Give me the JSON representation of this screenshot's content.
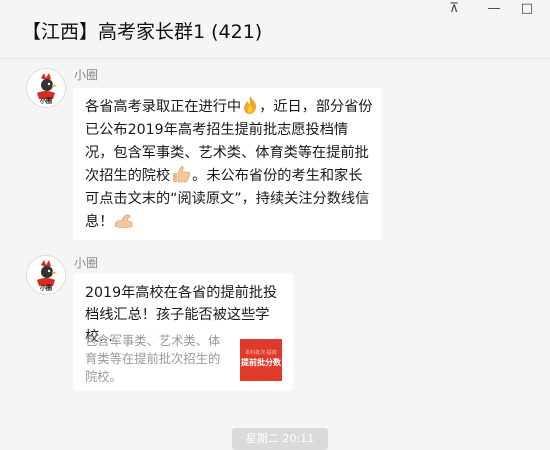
{
  "window": {
    "title": "【江西】高考家长群1 (421)",
    "controls": {
      "pin": "⊼",
      "minimize": "—",
      "maximize": "□",
      "close": "×"
    }
  },
  "messages": [
    {
      "sender": "小圈",
      "avatar_text": "小圈",
      "type": "text",
      "segments": [
        "各省高考录取正在进行中",
        "，近日，部分省份已公布2019年高考招生提前批志愿投档情况，包含军事类、艺术类、体育类等在提前批次招生的院校",
        "。未公布省份的考生和家长可点击文末的“阅读原文”，持续关注分数线信息！"
      ],
      "emojis": [
        "fire-icon",
        "thumbs-up-icon",
        "flexed-biceps-icon"
      ]
    },
    {
      "sender": "小圈",
      "avatar_text": "小圈",
      "type": "link_card",
      "card_title": "2019年高校在各省的提前批投档线汇总！孩子能否被这些学校...",
      "card_desc": "包含军事类、艺术类、体育类等在提前批次招生的院校。",
      "thumb_label": "提前批分数",
      "thumb_top_text": "本科批次·提前"
    }
  ],
  "time_divider": "星期二 20:11",
  "colors": {
    "background": "#f5f5f5",
    "bubble": "#ffffff",
    "thumb": "#e03a2b",
    "sender_name": "#888888"
  }
}
